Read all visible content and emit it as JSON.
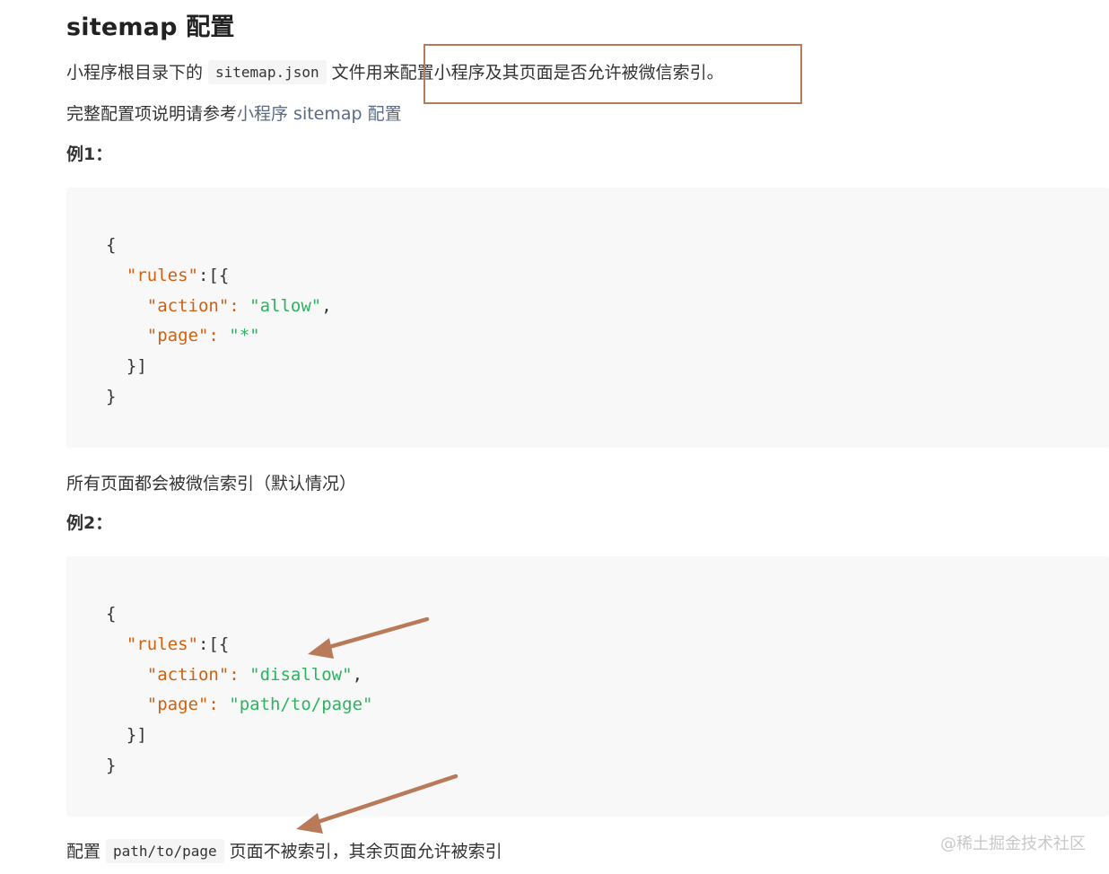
{
  "heading": "sitemap 配置",
  "intro": {
    "before": "小程序根目录下的",
    "code": "sitemap.json",
    "after": "文件用来配置小程序及其页面是否允许被微信索引。"
  },
  "ref": {
    "text": "完整配置项说明请参考",
    "link": "小程序 sitemap 配置"
  },
  "example1": {
    "label": "例1：",
    "caption": "所有页面都会被微信索引（默认情况）",
    "code": {
      "open": "{",
      "rules_key": "\"rules\"",
      "rules_open": ":[{",
      "action_key": "\"action\"",
      "action_colon": ": ",
      "action_value": "\"allow\"",
      "action_comma": ",",
      "page_key": "\"page\"",
      "page_colon": ": ",
      "page_value": "\"*\"",
      "rules_close": "}]",
      "close": "}"
    }
  },
  "example2": {
    "label": "例2：",
    "caption": {
      "before": "配置",
      "code": "path/to/page",
      "after": "页面不被索引，其余页面允许被索引"
    },
    "code": {
      "open": "{",
      "rules_key": "\"rules\"",
      "rules_open": ":[{",
      "action_key": "\"action\"",
      "action_colon": ": ",
      "action_value": "\"disallow\"",
      "action_comma": ",",
      "page_key": "\"page\"",
      "page_colon": ": ",
      "page_value": "\"path/to/page\"",
      "rules_close": "}]",
      "close": "}"
    }
  },
  "watermark": "@稀土掘金技术社区",
  "colors": {
    "json_key": "#d1600f",
    "json_string": "#2db35f",
    "annotation": "#b87a58",
    "link": "#5a6b86"
  }
}
